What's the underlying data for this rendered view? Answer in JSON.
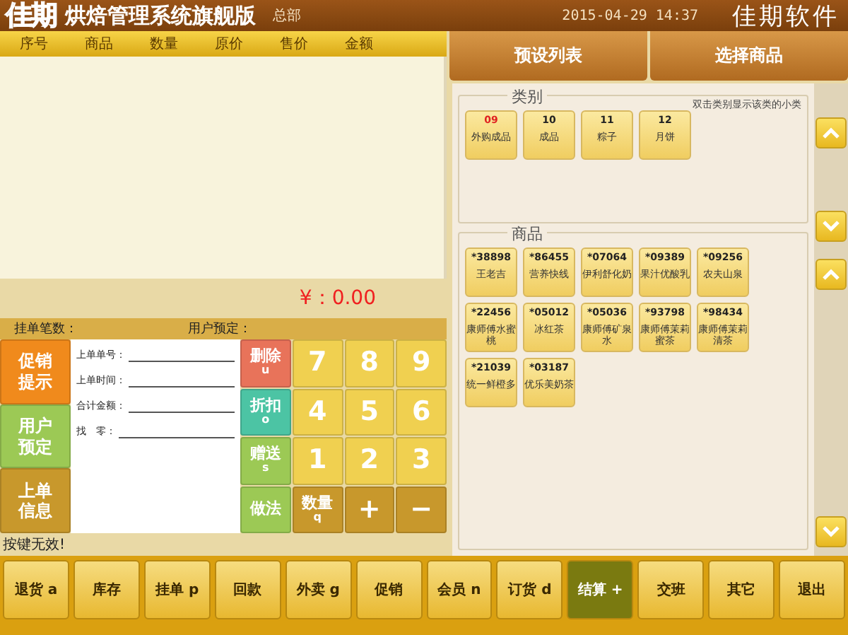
{
  "title_bar": {
    "logo_mark": "佳期",
    "app_name": "烘焙管理系统旗舰版",
    "branch": "总部",
    "datetime": "2015-04-29 14:37",
    "brand": "佳期软件"
  },
  "order_table": {
    "columns": [
      "序号",
      "商品",
      "数量",
      "原价",
      "售价",
      "金额"
    ]
  },
  "total": "¥：0.00",
  "info_row": {
    "pending_count_label": "挂单笔数：",
    "reservation_label": "用户预定："
  },
  "side_buttons": [
    {
      "label": "促销提示",
      "color": "#f08a1c"
    },
    {
      "label": "用户预定",
      "color": "#9cc955"
    },
    {
      "label": "上单信息",
      "color": "#c8982c"
    }
  ],
  "last_order": [
    {
      "label": "上单单号："
    },
    {
      "label": "上单时间："
    },
    {
      "label": "合计金额："
    },
    {
      "label": "找　零："
    }
  ],
  "keypad": [
    {
      "label": "删除",
      "shortcut": "u",
      "color": "#e8735a"
    },
    {
      "label": "7",
      "color": "#f0d050"
    },
    {
      "label": "8",
      "color": "#f0d050"
    },
    {
      "label": "9",
      "color": "#f0d050"
    },
    {
      "label": "折扣",
      "shortcut": "o",
      "color": "#4cc4a4"
    },
    {
      "label": "4",
      "color": "#f0d050"
    },
    {
      "label": "5",
      "color": "#f0d050"
    },
    {
      "label": "6",
      "color": "#f0d050"
    },
    {
      "label": "赠送",
      "shortcut": "s",
      "color": "#9cc955"
    },
    {
      "label": "1",
      "color": "#f0d050"
    },
    {
      "label": "2",
      "color": "#f0d050"
    },
    {
      "label": "3",
      "color": "#f0d050"
    },
    {
      "label": "做法",
      "color": "#9cc955"
    },
    {
      "label": "数量",
      "shortcut": "q",
      "color": "#c8982c"
    },
    {
      "label": "+",
      "color": "#c8982c"
    },
    {
      "label": "−",
      "color": "#c8982c"
    }
  ],
  "status": "按键无效!",
  "tabs": [
    {
      "label": "预设列表",
      "selected": false
    },
    {
      "label": "选择商品",
      "selected": false
    }
  ],
  "categories": {
    "legend": "类别",
    "hint": "双击类别显示该类的小类",
    "items": [
      {
        "code": "09",
        "name": "外购成品",
        "selected": true
      },
      {
        "code": "10",
        "name": "成品",
        "selected": false
      },
      {
        "code": "11",
        "name": "粽子",
        "selected": false
      },
      {
        "code": "12",
        "name": "月饼",
        "selected": false
      }
    ]
  },
  "products": {
    "legend": "商品",
    "items": [
      {
        "code": "*38898",
        "name": "王老吉"
      },
      {
        "code": "*86455",
        "name": "营养快线"
      },
      {
        "code": "*07064",
        "name": "伊利舒化奶"
      },
      {
        "code": "*09389",
        "name": "果汁优酸乳"
      },
      {
        "code": "*09256",
        "name": "农夫山泉"
      },
      {
        "code": "*22456",
        "name": "康师傅水蜜桃"
      },
      {
        "code": "*05012",
        "name": "冰红茶"
      },
      {
        "code": "*05036",
        "name": "康师傅矿泉水"
      },
      {
        "code": "*93798",
        "name": "康师傅茉莉蜜茶"
      },
      {
        "code": "*98434",
        "name": "康师傅茉莉清茶"
      },
      {
        "code": "*21039",
        "name": "统一鲜橙多"
      },
      {
        "code": "*03187",
        "name": "优乐美奶茶"
      }
    ]
  },
  "function_bar": [
    {
      "label": "退货 a",
      "selected": false
    },
    {
      "label": "库存",
      "selected": false
    },
    {
      "label": "挂单 p",
      "selected": false
    },
    {
      "label": "回款",
      "selected": false
    },
    {
      "label": "外卖 g",
      "selected": false
    },
    {
      "label": "促销",
      "selected": false
    },
    {
      "label": "会员 n",
      "selected": false
    },
    {
      "label": "订货 d",
      "selected": false
    },
    {
      "label": "结算 +",
      "selected": true
    },
    {
      "label": "交班",
      "selected": false
    },
    {
      "label": "其它",
      "selected": false
    },
    {
      "label": "退出",
      "selected": false
    }
  ]
}
